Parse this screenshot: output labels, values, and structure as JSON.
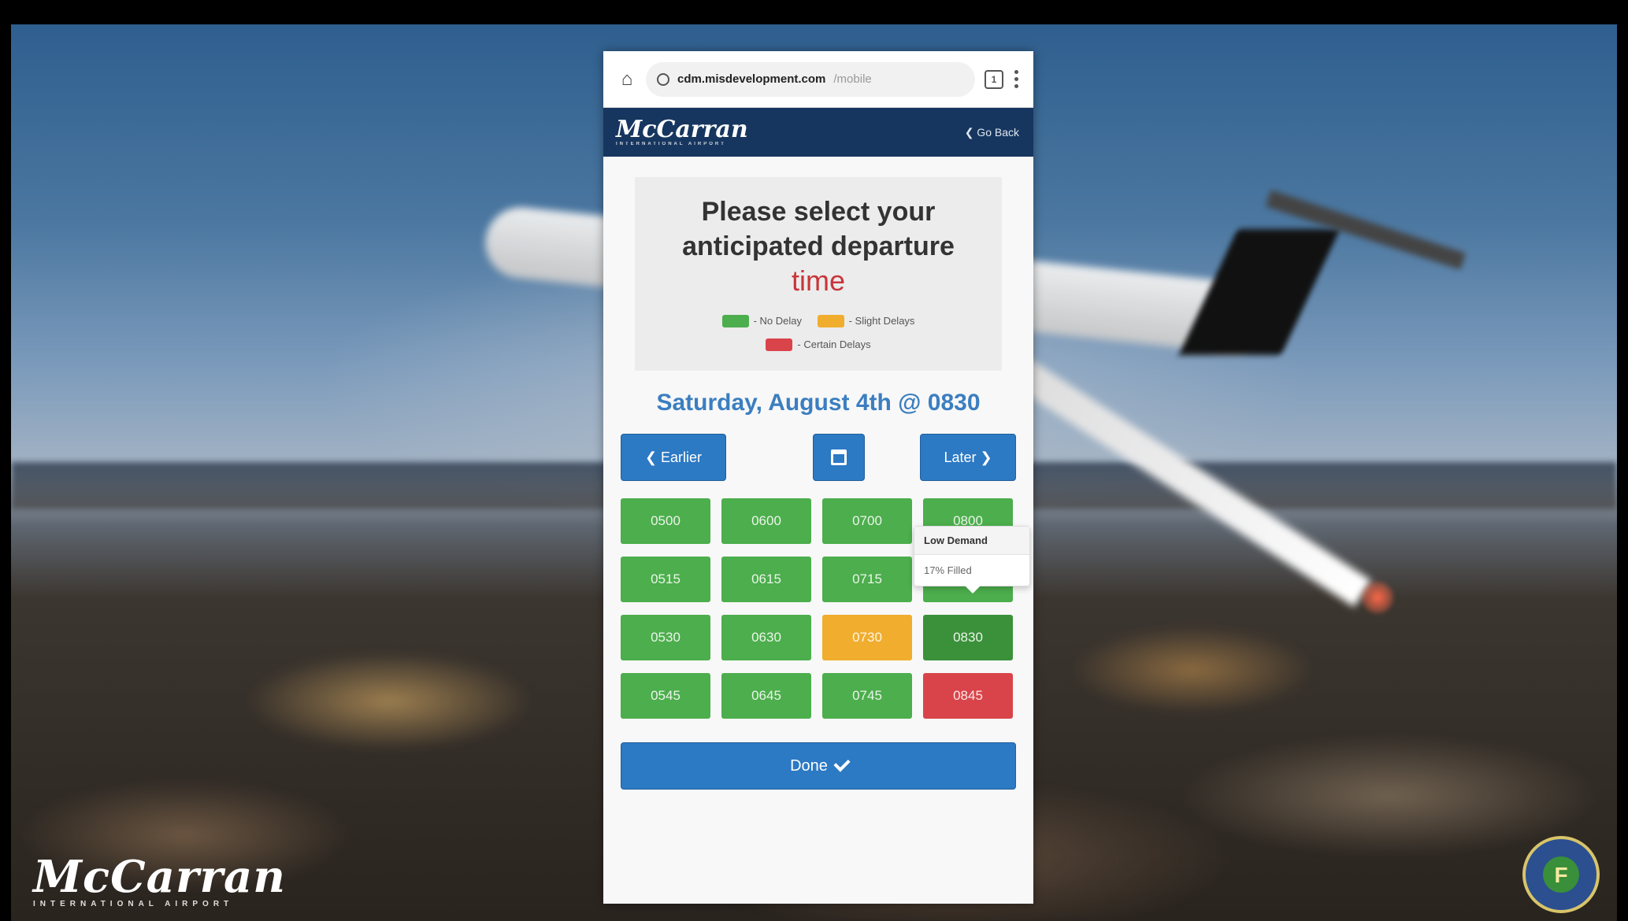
{
  "browser": {
    "url_host": "cdm.misdevelopment.com",
    "url_path": "/mobile",
    "tab_count": "1"
  },
  "site_header": {
    "logo_text": "McCarran",
    "logo_subtext": "INTERNATIONAL AIRPORT",
    "go_back_label": "❮ Go Back"
  },
  "prompt": {
    "line1": "Please select your",
    "line2": "anticipated departure",
    "line3": "time"
  },
  "legend": [
    {
      "label": "- No Delay",
      "color": "#4cae4c"
    },
    {
      "label": "- Slight Delays",
      "color": "#f0ad2e"
    },
    {
      "label": "- Certain Delays",
      "color": "#d9444a"
    }
  ],
  "selected_heading": "Saturday, August 4th @ 0830",
  "nav": {
    "earlier_label": "❮ Earlier",
    "later_label": "Later ❯",
    "calendar_icon": "calendar-icon"
  },
  "slots": [
    {
      "time": "0500",
      "status": "green"
    },
    {
      "time": "0600",
      "status": "green"
    },
    {
      "time": "0700",
      "status": "green"
    },
    {
      "time": "0800",
      "status": "green"
    },
    {
      "time": "0515",
      "status": "green"
    },
    {
      "time": "0615",
      "status": "green"
    },
    {
      "time": "0715",
      "status": "green"
    },
    {
      "time": "0815",
      "status": "green"
    },
    {
      "time": "0530",
      "status": "green"
    },
    {
      "time": "0630",
      "status": "green"
    },
    {
      "time": "0730",
      "status": "orange"
    },
    {
      "time": "0830",
      "status": "green-dark"
    },
    {
      "time": "0545",
      "status": "green"
    },
    {
      "time": "0645",
      "status": "green"
    },
    {
      "time": "0745",
      "status": "green"
    },
    {
      "time": "0845",
      "status": "red"
    }
  ],
  "tooltip": {
    "title": "Low Demand",
    "body": "17% Filled"
  },
  "done_label": "Done",
  "background": {
    "logo_text": "McCarran",
    "logo_subtext": "INTERNATIONAL AIRPORT",
    "seal_letter": "F"
  }
}
